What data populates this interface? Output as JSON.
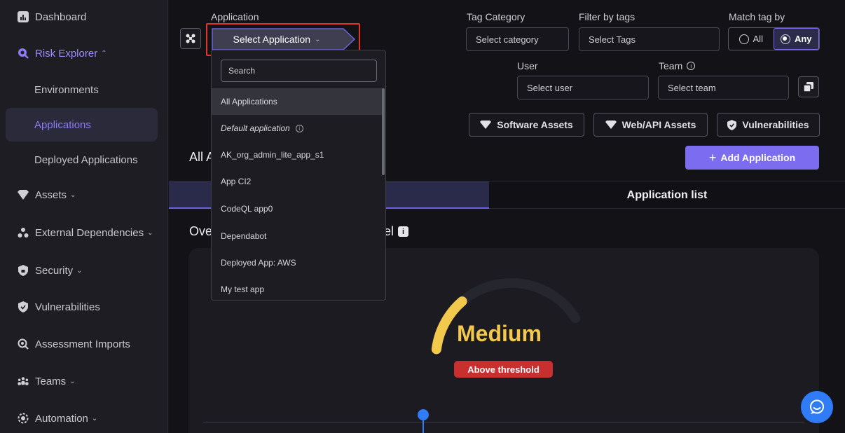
{
  "sidebar": {
    "dashboard": "Dashboard",
    "risk_explorer": "Risk Explorer",
    "environments": "Environments",
    "applications": "Applications",
    "deployed_applications": "Deployed Applications",
    "assets": "Assets",
    "external_dependencies": "External Dependencies",
    "security": "Security",
    "vulnerabilities": "Vulnerabilities",
    "assessment_imports": "Assessment Imports",
    "teams": "Teams",
    "automation": "Automation"
  },
  "filters": {
    "application_label": "Application",
    "select_application": "Select Application",
    "tag_category_label": "Tag Category",
    "tag_category_placeholder": "Select category",
    "filter_by_tags_label": "Filter by tags",
    "filter_by_tags_placeholder": "Select Tags",
    "match_tag_by_label": "Match tag by",
    "match_all": "All",
    "match_any": "Any",
    "match_selected": "Any",
    "user_label": "User",
    "user_placeholder": "Select user",
    "team_label": "Team",
    "team_placeholder": "Select team"
  },
  "asset_buttons": {
    "software": "Software Assets",
    "webapi": "Web/API Assets",
    "vulnerabilities": "Vulnerabilities"
  },
  "actions": {
    "add_application": "Add Application"
  },
  "main": {
    "heading_all": "All A",
    "tab_application_list": "Application list",
    "heading_overview_start": "Ove",
    "heading_overview_end": "el"
  },
  "gauge": {
    "level": "Medium",
    "badge": "Above threshold",
    "fill_fraction": 0.3
  },
  "dropdown": {
    "search_placeholder": "Search",
    "items": [
      "All Applications",
      "Default application",
      "AK_org_admin_lite_app_s1",
      "App CI2",
      "CodeQL app0",
      "Dependabot",
      "Deployed App: AWS",
      "My test app"
    ]
  },
  "colors": {
    "accent": "#7b6cf0",
    "highlight": "#e0352b",
    "gauge": "#f2c94c",
    "badge": "#c7302f",
    "chat": "#2f7cf6"
  }
}
